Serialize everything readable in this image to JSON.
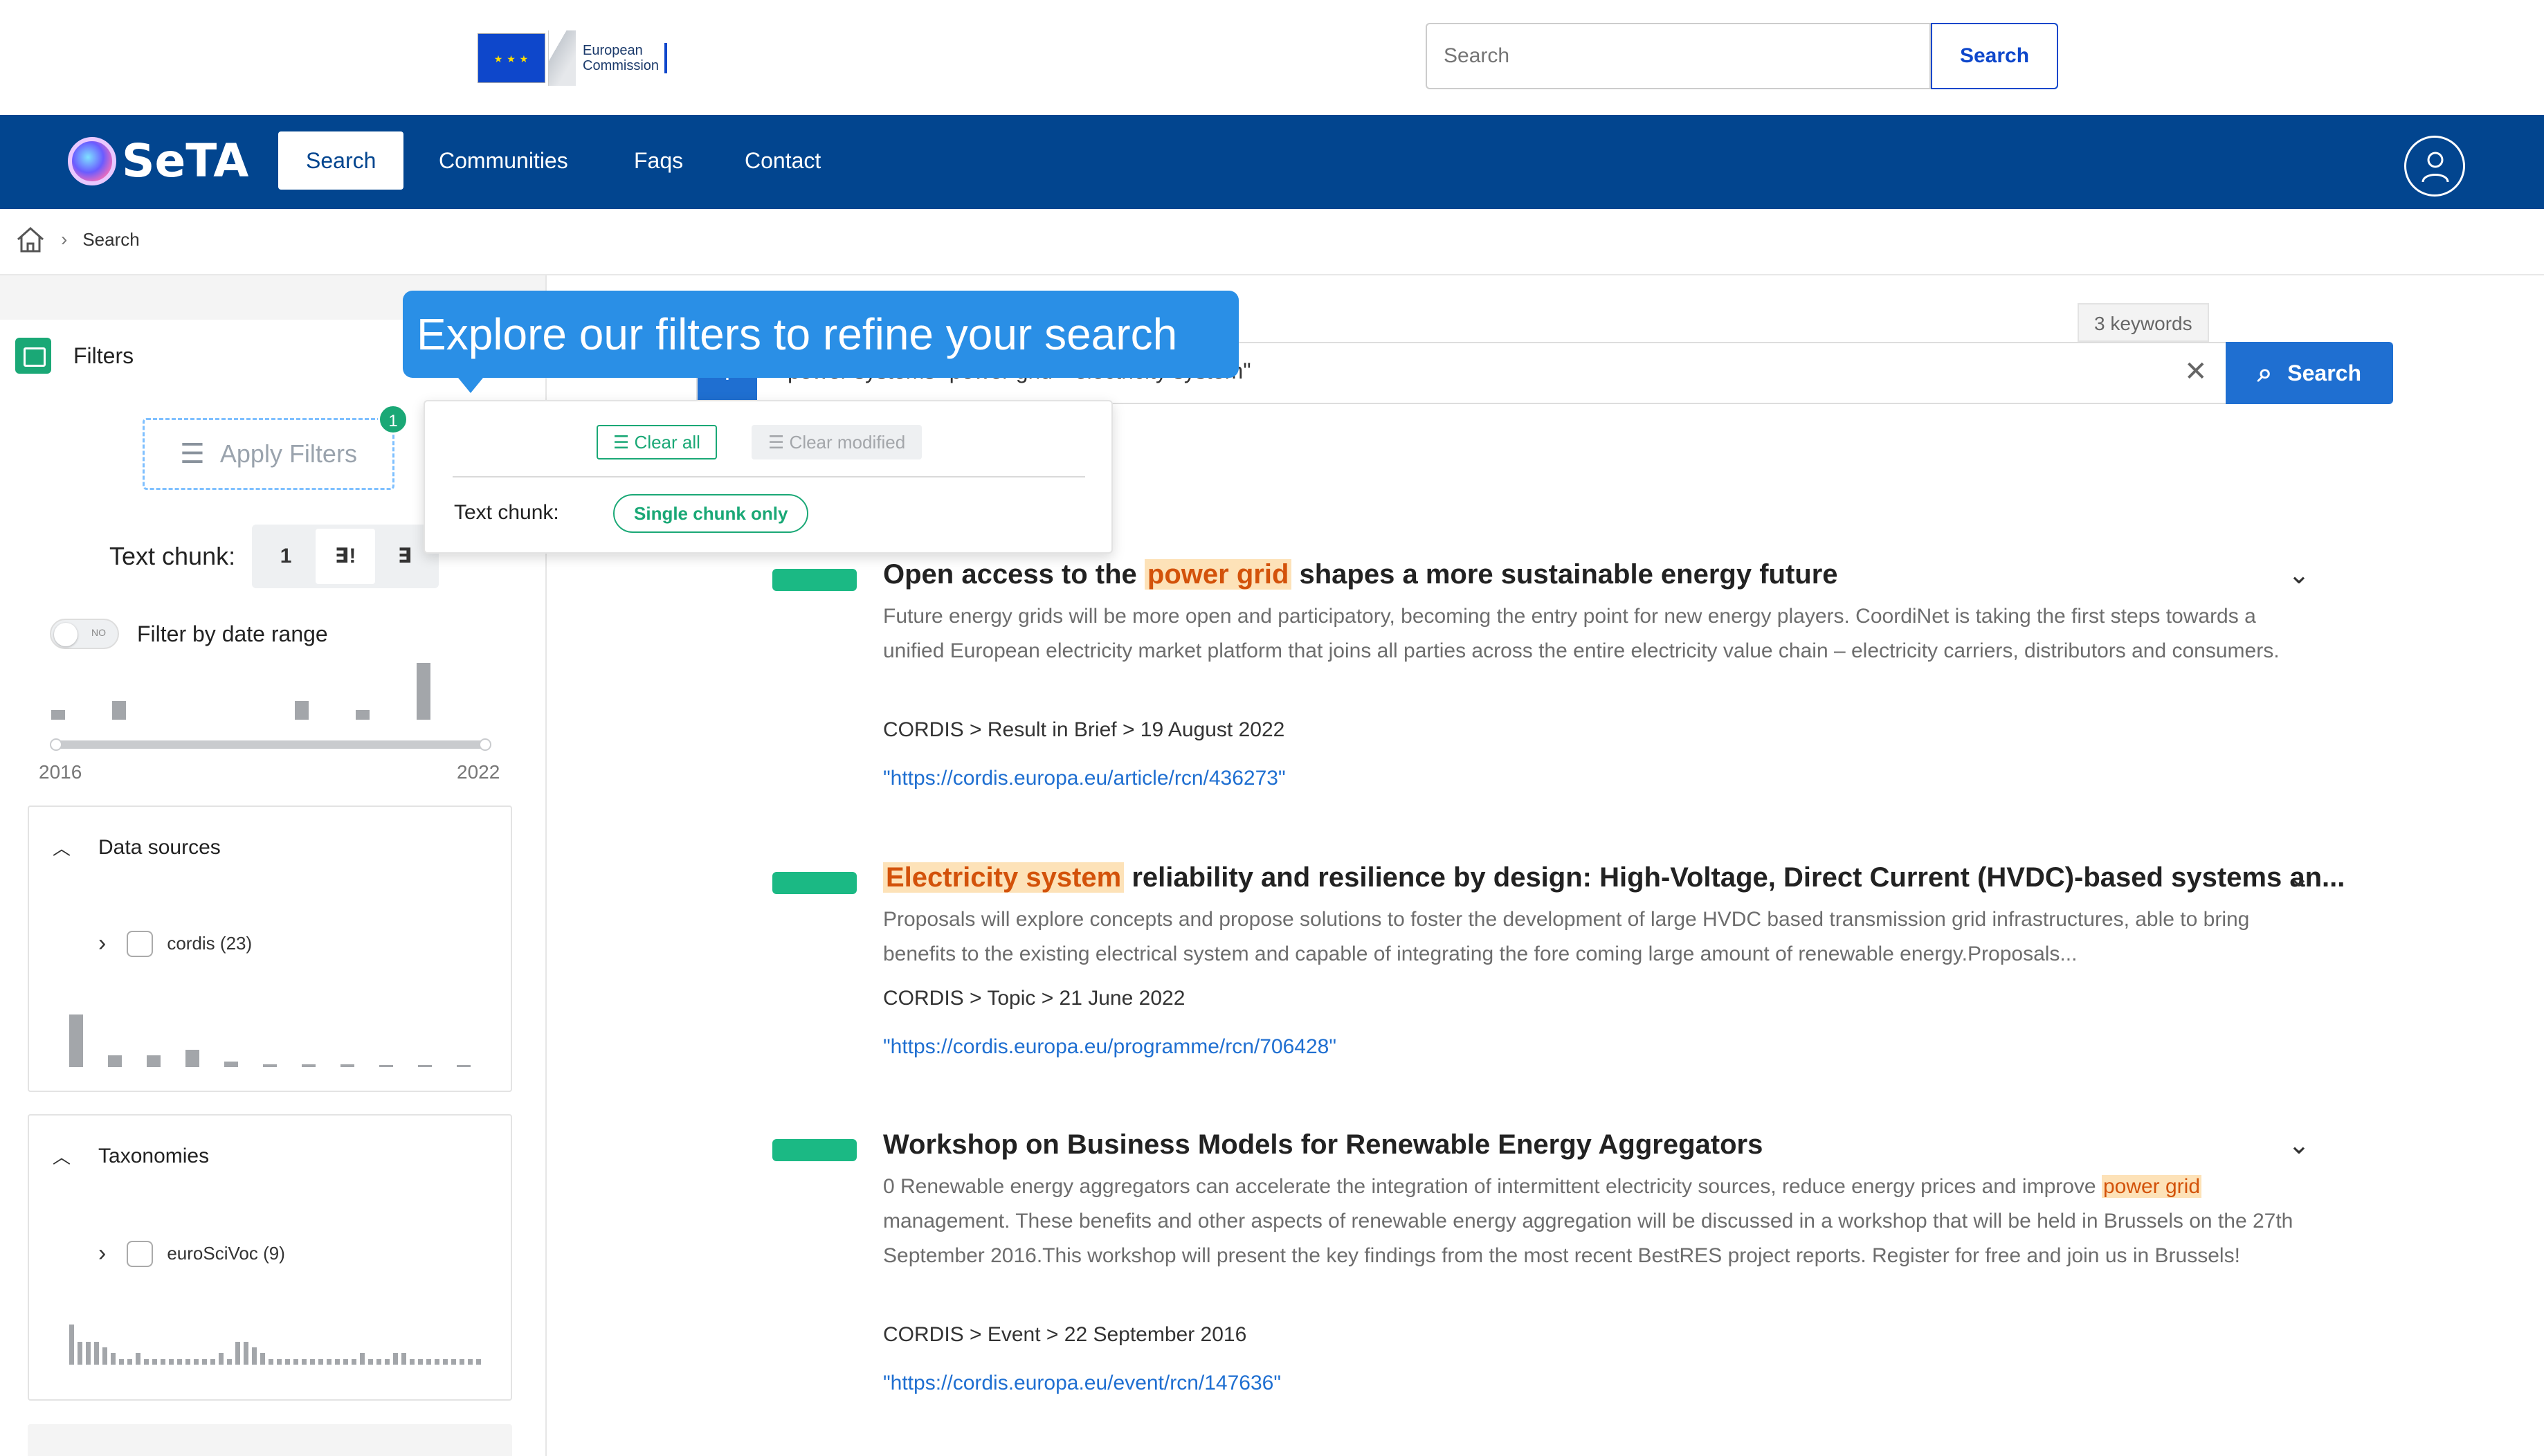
{
  "header": {
    "ec_logo_text": [
      "European",
      "Commission"
    ],
    "search_placeholder": "Search",
    "search_button": "Search"
  },
  "nav": {
    "brand": "SeTA",
    "items": [
      {
        "label": "Search",
        "active": true
      },
      {
        "label": "Communities",
        "active": false
      },
      {
        "label": "Faqs",
        "active": false
      },
      {
        "label": "Contact",
        "active": false
      }
    ]
  },
  "breadcrumb": {
    "current": "Search"
  },
  "sidebar": {
    "filters_label": "Filters",
    "apply_filters": "Apply Filters",
    "badge_count": "1",
    "text_chunk_label": "Text chunk:",
    "chunk_options": [
      "1",
      "∃!",
      "∃"
    ],
    "date_toggle_label": "Filter by date range",
    "date_toggle_state": "NO",
    "date_histogram": [
      {
        "year": "2016",
        "value": 1
      },
      {
        "year": "2017",
        "value": 2
      },
      {
        "year": "2018",
        "value": 0
      },
      {
        "year": "2019",
        "value": 0
      },
      {
        "year": "2020",
        "value": 2
      },
      {
        "year": "2021",
        "value": 1
      },
      {
        "year": "2022",
        "value": 6
      }
    ],
    "year_min": "2016",
    "year_max": "2022",
    "data_sources": {
      "title": "Data sources",
      "item": "cordis (23)",
      "histogram": [
        9,
        2,
        2,
        3,
        1,
        0.5,
        0.5,
        0.5,
        0.3,
        0.3,
        0.2
      ]
    },
    "taxonomies": {
      "title": "Taxonomies",
      "item": "euroSciVoc (9)",
      "histogram": [
        7,
        4,
        4,
        4,
        3,
        2,
        1,
        1,
        2,
        1,
        1,
        1,
        1,
        1,
        1,
        1,
        1,
        1,
        2,
        1,
        4,
        4,
        3,
        2,
        1,
        1,
        1,
        1,
        1,
        1,
        1,
        1,
        1,
        1,
        1,
        2,
        1,
        1,
        1,
        2,
        2,
        1,
        1,
        1,
        1,
        1,
        1,
        1,
        1,
        1
      ]
    }
  },
  "query": {
    "keywords_tag": "3 keywords",
    "text": "power systems  \"power grid\"  \"electricity system\"",
    "button": "Search"
  },
  "tour": {
    "tooltip": "Explore our filters to refine your search",
    "clear_all": "Clear all",
    "clear_modified": "Clear modified",
    "text_chunk_label": "Text chunk:",
    "chip": "Single chunk only"
  },
  "results": [
    {
      "title_pre": "Open access to the ",
      "title_hl": "power grid",
      "title_post": " shapes a more sustainable energy future",
      "snippet": "Future energy grids will be more open and participatory, becoming the entry point for new energy players. CoordiNet is taking the first steps towards a unified European electricity market platform that joins all parties across the entire electricity value chain – electricity carriers, distributors and consumers.",
      "meta": "CORDIS > Result in Brief > 19 August 2022",
      "link": "\"https://cordis.europa.eu/article/rcn/436273\""
    },
    {
      "title_hl": "Electricity system",
      "title_post": " reliability and resilience by design: High-Voltage, Direct Current (HVDC)-based systems an...",
      "snippet": "Proposals will explore concepts and propose solutions to foster the development of large HVDC based transmission grid infrastructures, able to bring benefits to the existing electrical system and capable of integrating the fore coming large amount of renewable energy.Proposals...",
      "meta": "CORDIS > Topic > 21 June 2022",
      "link": "\"https://cordis.europa.eu/programme/rcn/706428\""
    },
    {
      "title": "Workshop on Business Models for Renewable Energy Aggregators",
      "snippet_pre": "0 Renewable energy aggregators can accelerate the integration of intermittent electricity sources, reduce energy prices and improve ",
      "snippet_hl": "power grid",
      "snippet_post": " management. These benefits and other aspects of renewable energy aggregation will be discussed in a workshop that will be held in Brussels on the 27th September 2016.This workshop will present the key findings from the most recent BestRES project reports. Register for free and join us in Brussels!",
      "meta": "CORDIS > Event > 22 September 2016",
      "link": "\"https://cordis.europa.eu/event/rcn/147636\""
    }
  ],
  "colors": {
    "nav": "#02458f",
    "accent": "#1f6fd1",
    "green": "#1aa876",
    "highlight": "#fde2b8"
  }
}
